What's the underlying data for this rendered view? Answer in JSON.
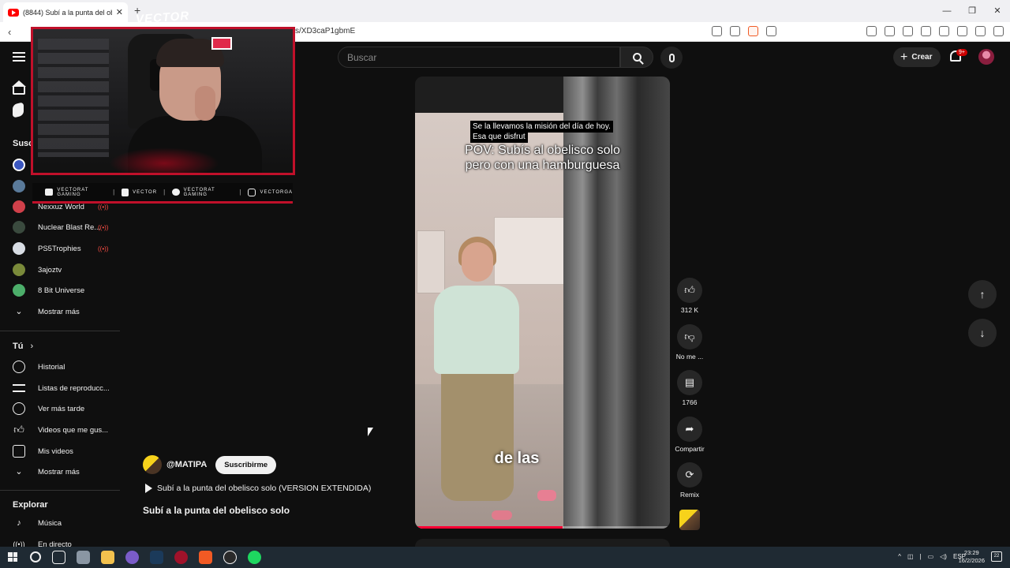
{
  "browser": {
    "tab_title": "(8844) Subí a la punta del obe",
    "tab_close": "✕",
    "new_tab": "+",
    "url": "s/XD3caP1gbmE",
    "window_controls": [
      "—",
      "❐",
      "✕"
    ]
  },
  "header": {
    "search_placeholder": "Buscar",
    "create_label": "Crear",
    "notification_badge": "9+"
  },
  "sidebar": {
    "subscriptions_heading": "Susc",
    "channels": [
      {
        "name": "Nexxuz World",
        "live": "((•))",
        "color": "#d0404a"
      },
      {
        "name": "Nuclear Blast Re...",
        "live": "((•))",
        "color": "#3a4a3e"
      },
      {
        "name": "PS5Trophies",
        "live": "((•))",
        "color": "#d8dde4"
      },
      {
        "name": "3ajoztv",
        "live": "",
        "color": "#7a8a3a"
      },
      {
        "name": "8 Bit Universe",
        "live": "",
        "color": "#4cae6a"
      }
    ],
    "show_more_1": "Mostrar más",
    "you_heading": "Tú",
    "you_chevron": "›",
    "you_items": [
      "Historial",
      "Listas de reproducc...",
      "Ver más tarde",
      "Videos que me gus...",
      "Mis videos"
    ],
    "show_more_2": "Mostrar más",
    "explore_heading": "Explorar",
    "explore_items": [
      "Música",
      "En directo"
    ]
  },
  "overlay": {
    "brand": "VECTOR",
    "socials": [
      {
        "label": "VECTORAT GAMING"
      },
      {
        "label": "VECTOR"
      },
      {
        "label": "VECTORAT GAMING"
      },
      {
        "label": "VECTORGA"
      }
    ],
    "separator": "|"
  },
  "short": {
    "caption_line1": "Se la llevamos la misión del día de hoy.",
    "caption_line2": "Esa que disfrut",
    "overlay_title_line1": "POV: Subís al obelisco solo",
    "overlay_title_line2": "pero con una hamburguesa",
    "subtitle": "de las",
    "progress": 0.58,
    "channel": "@MATIPA",
    "subscribe_label": "Suscribirme",
    "playlist_label": "Subí a la punta del obelisco solo (VERSION EXTENDIDA)",
    "title": "Subí a la punta del obelisco solo"
  },
  "actions": {
    "like_count": "312 K",
    "dislike_label": "No me ...",
    "comments_count": "1766",
    "share_label": "Compartir",
    "remix_label": "Remix"
  },
  "taskbar": {
    "lang": "ESP",
    "time": "23:29",
    "date": "16/2/2026",
    "notif_count": "22"
  },
  "colors": {
    "background": "#0f0f0f",
    "accent_red": "#ff0033",
    "overlay_red": "#c0102a"
  }
}
